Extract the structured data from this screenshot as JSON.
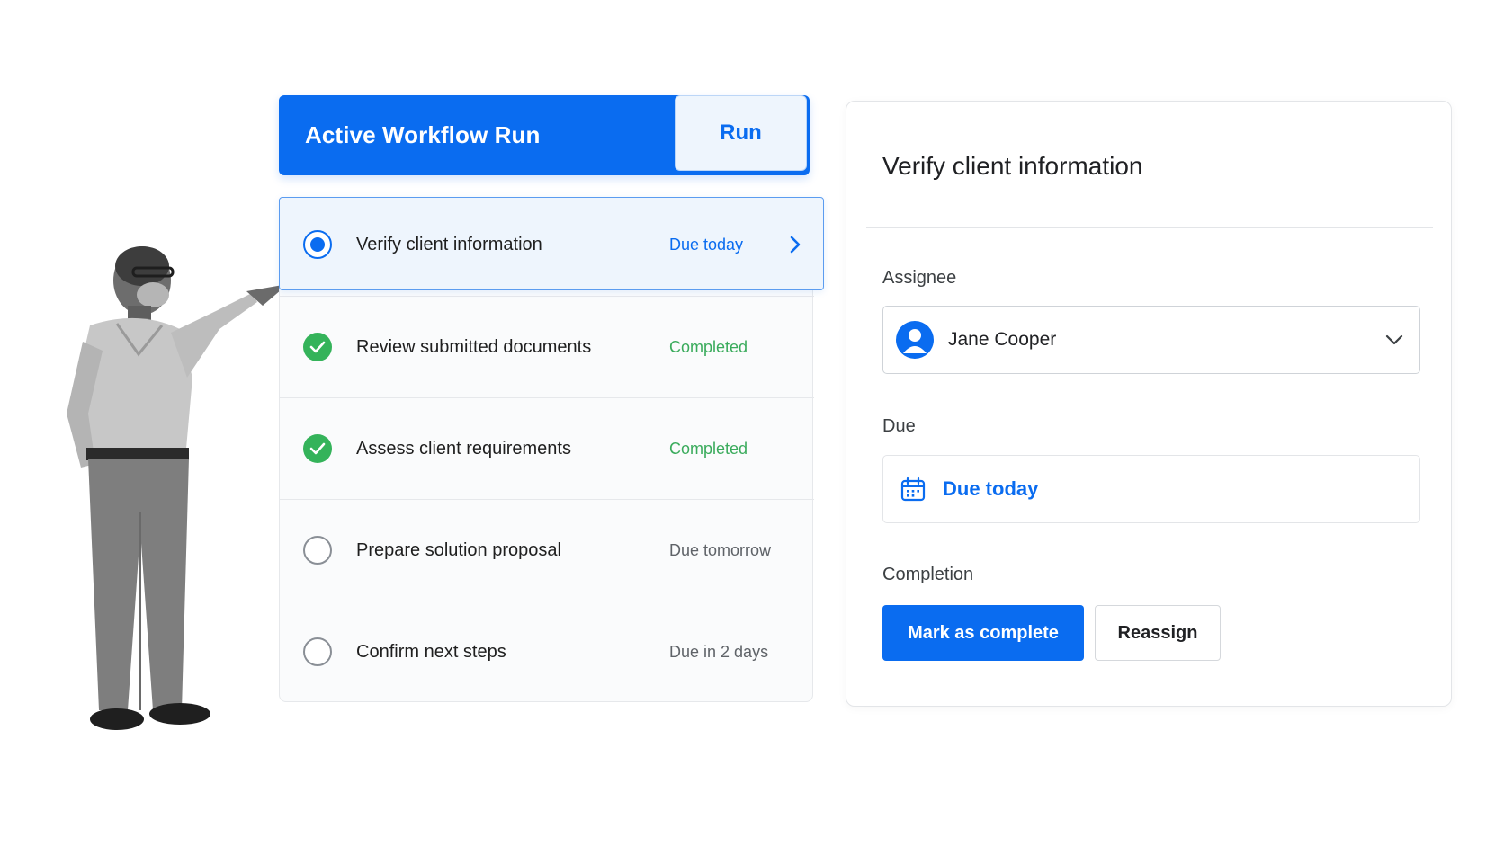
{
  "header": {
    "title": "Active Workflow Run",
    "run_tab": "Run"
  },
  "tasks": [
    {
      "label": "Verify client information",
      "status": "Due today",
      "state": "active"
    },
    {
      "label": "Review submitted documents",
      "status": "Completed",
      "state": "completed"
    },
    {
      "label": "Assess client requirements",
      "status": "Completed",
      "state": "completed"
    },
    {
      "label": "Prepare solution proposal",
      "status": "Due tomorrow",
      "state": "pending"
    },
    {
      "label": "Confirm next steps",
      "status": "Due in 2 days",
      "state": "pending"
    }
  ],
  "detail": {
    "title": "Verify client information",
    "assignee_label": "Assignee",
    "assignee_name": "Jane Cooper",
    "due_label": "Due",
    "due_value": "Due today",
    "completion_label": "Completion",
    "mark_complete": "Mark as complete",
    "reassign": "Reassign"
  },
  "colors": {
    "accent": "#0a6cf0",
    "completed": "#34b35a",
    "active_row_bg": "#eef5fd"
  },
  "icons": [
    "chevron-right-icon",
    "check-icon",
    "radio-selected-icon",
    "radio-empty-icon",
    "user-avatar-icon",
    "chevron-down-icon",
    "calendar-icon"
  ]
}
